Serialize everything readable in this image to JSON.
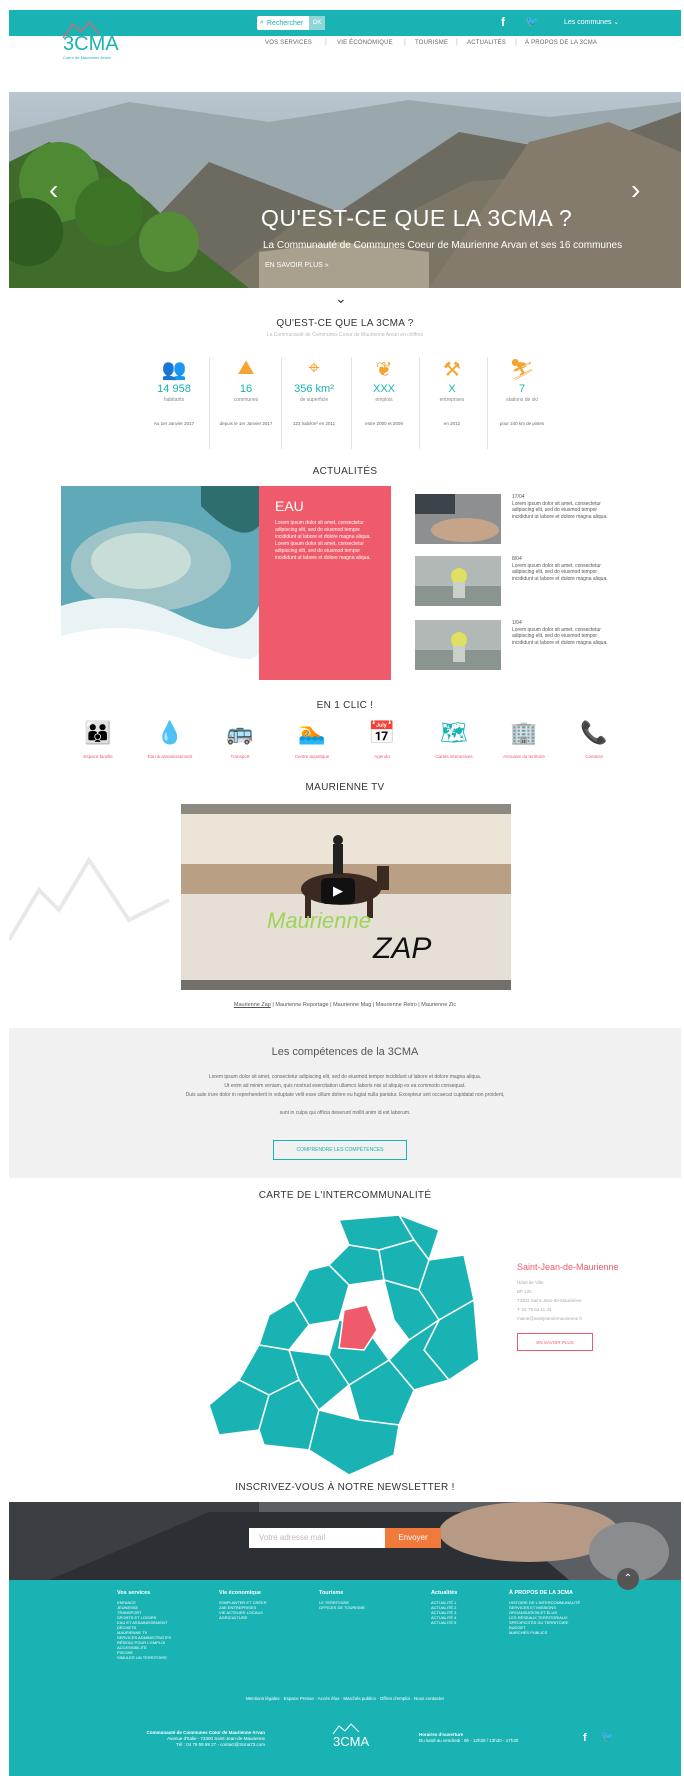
{
  "topbar": {
    "search_label": "Rechercher",
    "search_go": "OK",
    "communes_label": "Les communes"
  },
  "nav": {
    "items": [
      "VOS SERVICES",
      "VIE ÉCONOMIQUE",
      "TOURISME",
      "ACTUALITÉS",
      "À PROPOS DE LA 3CMA"
    ],
    "separator": "|"
  },
  "logo": {
    "text": "3CMA",
    "tagline": "Coeur de Maurienne Arvan"
  },
  "hero": {
    "title": "QU'EST-CE QUE LA 3CMA ?",
    "subtitle": "La Communauté de Communes Coeur de Maurienne Arvan et ses 16 communes",
    "more": "EN SAVOIR PLUS »",
    "prev": "‹",
    "next": "›"
  },
  "scroll_chevron": "⌄",
  "about": {
    "title": "QU'EST-CE QUE LA 3CMA ?",
    "subtitle": "La Communauté de Communes Coeur de Maurienne Arvan en chiffres",
    "stats": [
      {
        "icon": "people-icon",
        "value": "14 958",
        "label": "habitants",
        "note": "Au 1er Janvier 2017"
      },
      {
        "icon": "road-icon",
        "value": "16",
        "label": "communes",
        "note": "depuis le 1er Janvier 2017"
      },
      {
        "icon": "map-pin-icon",
        "value": "356 km²",
        "label": "de superficie",
        "note": "123 hab/km² en 2011"
      },
      {
        "icon": "leaf-icon",
        "value": "XXX",
        "label": "emplois",
        "note": "entre 2000 et 2009"
      },
      {
        "icon": "worker-icon",
        "value": "X",
        "label": "entreprises",
        "note": "en 2012"
      },
      {
        "icon": "skier-icon",
        "value": "7",
        "label": "stations de ski",
        "note": "pour 240 km de pistes"
      }
    ]
  },
  "news": {
    "title": "ACTUALITÉS",
    "featured": {
      "title": "EAU",
      "text": "Lorem ipsum dolor sit amet, consectetur adipiscing elit, sed do eiusmod tempor incididunt ut labore et dolore magna aliqua. Lorem ipsum dolor sit amet, consectetur adipiscing elit, sed do eiusmod tempor incididunt ut labore et dolore magna aliqua."
    },
    "items": [
      {
        "date": "17/04",
        "text": "Lorem ipsum dolor sit amet, consectetur adipiscing elit, sed do eiusmod tempor incididunt ut labore et dolore magna aliqua."
      },
      {
        "date": "8/04",
        "text": "Lorem ipsum dolor sit amet, consectetur adipiscing elit, sed do eiusmod tempor incididunt ut labore et dolore magna aliqua."
      },
      {
        "date": "1/04",
        "text": "Lorem ipsum dolor sit amet, consectetur adipiscing elit, sed do eiusmod tempor incididunt ut labore et dolore magna aliqua."
      }
    ]
  },
  "clic": {
    "title": "EN 1 CLIC !",
    "items": [
      {
        "icon": "family-icon",
        "label": "Espace famille"
      },
      {
        "icon": "water-drop-icon",
        "label": "Eau & assainissement"
      },
      {
        "icon": "bus-icon",
        "label": "Transport"
      },
      {
        "icon": "pool-icon",
        "label": "Centre aquatique"
      },
      {
        "icon": "calendar-icon",
        "label": "Agenda"
      },
      {
        "icon": "map-icon",
        "label": "Cartes interactives"
      },
      {
        "icon": "building-icon",
        "label": "Annuaire du territoire"
      },
      {
        "icon": "phone-icon",
        "label": "Contacts"
      }
    ]
  },
  "tv": {
    "title": "MAURIENNE TV",
    "brand_top": "Maurienne",
    "brand_bottom": "ZAP",
    "links": [
      "Maurienne Zap",
      "Maurienne Reportage",
      "Maurienne Mag",
      "Maurienne Retro",
      "Maurienne Zic"
    ]
  },
  "competences": {
    "title": "Les compétences de la 3CMA",
    "lines": [
      "Lorem ipsum dolor sit amet, consectetur adipiscing elit, sed do eiusmod tempor incididunt ut labore et dolore magna aliqua.",
      "Ut enim ad minim veniam, quis nostrud exercitation ullamco laboris nisi ut aliquip ex ea commodo consequat.",
      "Duis aute irure dolor in reprehenderit in voluptate velit esse cillum dolore eu fugiat nulla pariatur. Excepteur sint occaecat cupidatat non proident,",
      "sunt in culpa qui officia deserunt mollit anim id est laborum."
    ],
    "button": "COMPRENDRE LES COMPÉTENCES"
  },
  "map": {
    "title": "CARTE DE L'INTERCOMMUNALITÉ",
    "selected": {
      "name": "Saint-Jean-de-Maurienne",
      "lines": [
        "Hôtel de Ville",
        "BP 125",
        "73302 Saint-Jean-de-Maurienne",
        "T. 04 79 64 11 44",
        "mairie@saintjeandemaurienne.fr"
      ],
      "button": "EN SAVOIR PLUS"
    },
    "colors": {
      "commune": "#1ab3b4",
      "selected": "#f05b6b"
    }
  },
  "newsletter": {
    "title": "INSCRIVEZ-VOUS À NOTRE NEWSLETTER !",
    "placeholder": "Votre adresse mail",
    "button": "Envoyer",
    "to_top": "⌃"
  },
  "footer": {
    "columns": [
      {
        "title": "Vos services",
        "items": [
          "ENFANCE",
          "JEUNESSE",
          "TRANSPORT",
          "SPORTS ET LOISIRS",
          "EAU ET ASSAINISSEMENT",
          "DÉCHETS",
          "MAURIENNE TV",
          "SERVICES ADMINISTRATIFS",
          "RÉSEAU POUR L'EMPLOI",
          "ACCESSIBILITÉ",
          "PISCINE",
          "SIMULER UN TERRITOIRE"
        ]
      },
      {
        "title": "Vie économique",
        "items": [
          "S'IMPLANTER ET CRÉER",
          "ZAE ENTREPRISES",
          "VIE ACTEURS LOCAUX",
          "AGRICULTURE"
        ]
      },
      {
        "title": "Tourisme",
        "items": [
          "LE TERRITOIRE",
          "OFFICES DE TOURISME"
        ]
      },
      {
        "title": "Actualités",
        "items": [
          "ACTUALITÉ 1",
          "ACTUALITÉ 2",
          "ACTUALITÉ 3",
          "ACTUALITÉ 4",
          "ACTUALITÉ 5"
        ]
      },
      {
        "title": "À PROPOS DE LA 3CMA",
        "items": [
          "HISTOIRE DE L'INTERCOMMUNALITÉ",
          "SERVICES ET MISSIONS",
          "ORGANISATION ET ÉLUS",
          "LES RÉSEAUX TERRITORIAUX",
          "SPÉCIFICITÉS DU TERRITOIRE",
          "BUDGET",
          "MARCHÉS PUBLICS"
        ]
      }
    ],
    "links": "Mentions légales · Espace Presse · Accès élus · Marchés publics · Offres d'emploi · Nous contacter",
    "address": [
      "Communauté de Communes Cœur de Maurienne Arvan",
      "Avenue d'Italie - 73300 Saint-Jean-de-Maurienne",
      "Tél : 04 79 59 89 27 - contact@3cma73.com"
    ],
    "hours": [
      "Horaires d'ouverture",
      "Du lundi au vendredi : 9h - 12h30 / 13h30 - 17h30"
    ]
  }
}
